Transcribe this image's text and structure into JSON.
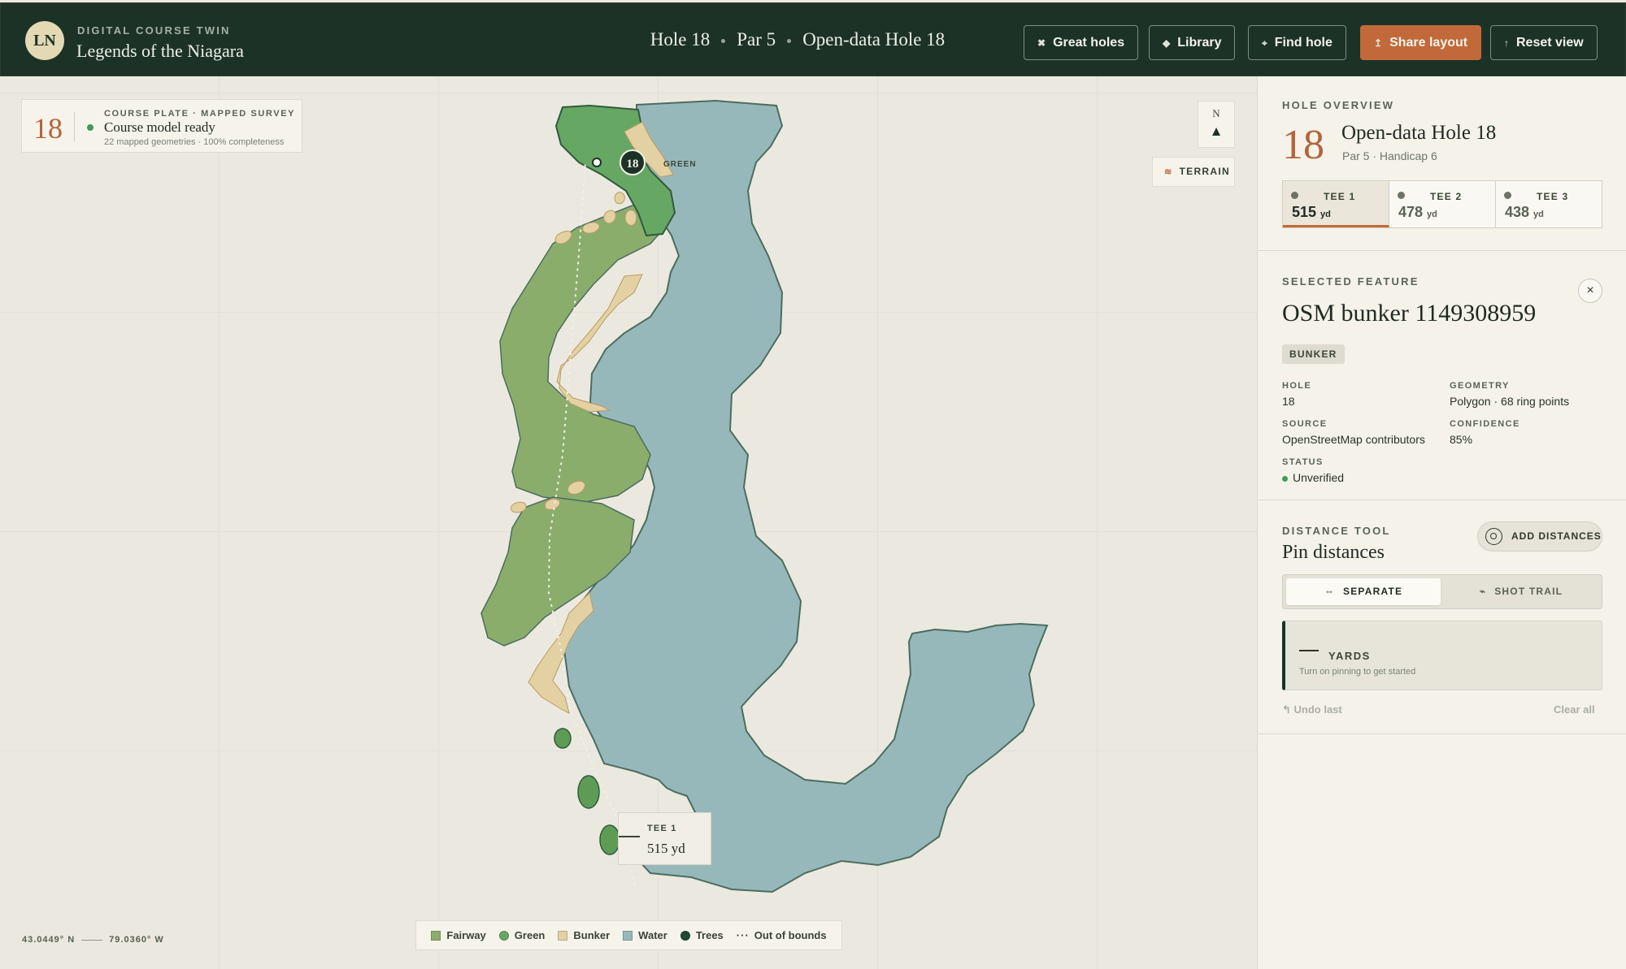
{
  "app": {
    "badge": "LN",
    "eyebrow": "DIGITAL COURSE TWIN",
    "course_name": "Legends of the Niagara"
  },
  "header": {
    "hole": "Hole 18",
    "par": "Par 5",
    "hole_name": "Open-data Hole 18",
    "buttons": [
      {
        "label": "Great holes",
        "icon": "star-icon"
      },
      {
        "label": "Library",
        "icon": "diamond-icon"
      },
      {
        "label": "Find hole",
        "icon": "crosshair-icon"
      },
      {
        "label": "Share layout",
        "icon": "share-icon"
      },
      {
        "label": "Reset view",
        "icon": "arrow-up-icon"
      }
    ]
  },
  "map": {
    "plate": {
      "number": "18",
      "eyebrow": "COURSE PLATE · MAPPED SURVEY",
      "status": "Course model ready",
      "sub": "22 mapped geometries · 100% completeness"
    },
    "north_label": "N",
    "terrain_label": "TERRAIN",
    "pin_number": "18",
    "green_label": "GREEN",
    "tee_callout": {
      "label": "TEE 1",
      "value": "515 yd"
    },
    "coords": {
      "lat": "43.0449° N",
      "lon": "79.0360° W"
    },
    "legend": [
      {
        "label": "Fairway",
        "color": "#8aad6c",
        "shape": "square"
      },
      {
        "label": "Green",
        "color": "#66a763",
        "shape": "circle"
      },
      {
        "label": "Bunker",
        "color": "#e3d1a3",
        "shape": "square"
      },
      {
        "label": "Water",
        "color": "#97b8bb",
        "shape": "square"
      },
      {
        "label": "Trees",
        "color": "#1f4a33",
        "shape": "circle"
      },
      {
        "label": "Out of bounds",
        "color": "#3a4434",
        "shape": "dots"
      }
    ],
    "colors": {
      "fairway": "#8aad6c",
      "green": "#66a763",
      "bunker": "#e3d1a3",
      "water": "#97b8bb",
      "trees": "#5e9c56",
      "outline": "#4b6d5e"
    }
  },
  "panel": {
    "overview": {
      "eyebrow": "HOLE OVERVIEW",
      "number": "18",
      "title": "Open-data Hole 18",
      "sub": "Par 5 · Handicap 6",
      "tees": [
        {
          "name": "TEE 1",
          "yards": "515",
          "unit": "yd",
          "active": true
        },
        {
          "name": "TEE 2",
          "yards": "478",
          "unit": "yd",
          "active": false
        },
        {
          "name": "TEE 3",
          "yards": "438",
          "unit": "yd",
          "active": false
        }
      ]
    },
    "feature": {
      "eyebrow": "SELECTED FEATURE",
      "title": "OSM bunker 1149308959",
      "close": "×",
      "tag": "BUNKER",
      "hole_label": "HOLE",
      "hole_value": "18",
      "geometry_label": "GEOMETRY",
      "geometry_value": "Polygon · 68 ring points",
      "source_label": "SOURCE",
      "source_value": "OpenStreetMap contributors",
      "confidence_label": "CONFIDENCE",
      "confidence_value": "85%",
      "status_label": "STATUS",
      "status_value": "Unverified"
    },
    "distance": {
      "eyebrow": "DISTANCE TOOL",
      "title": "Pin distances",
      "add_label": "ADD DISTANCES",
      "mode_separate": "SEPARATE",
      "mode_trail": "SHOT TRAIL",
      "yards_label": "YARDS",
      "hint": "Turn on pinning to get started",
      "undo": "Undo last",
      "clear": "Clear all"
    }
  }
}
